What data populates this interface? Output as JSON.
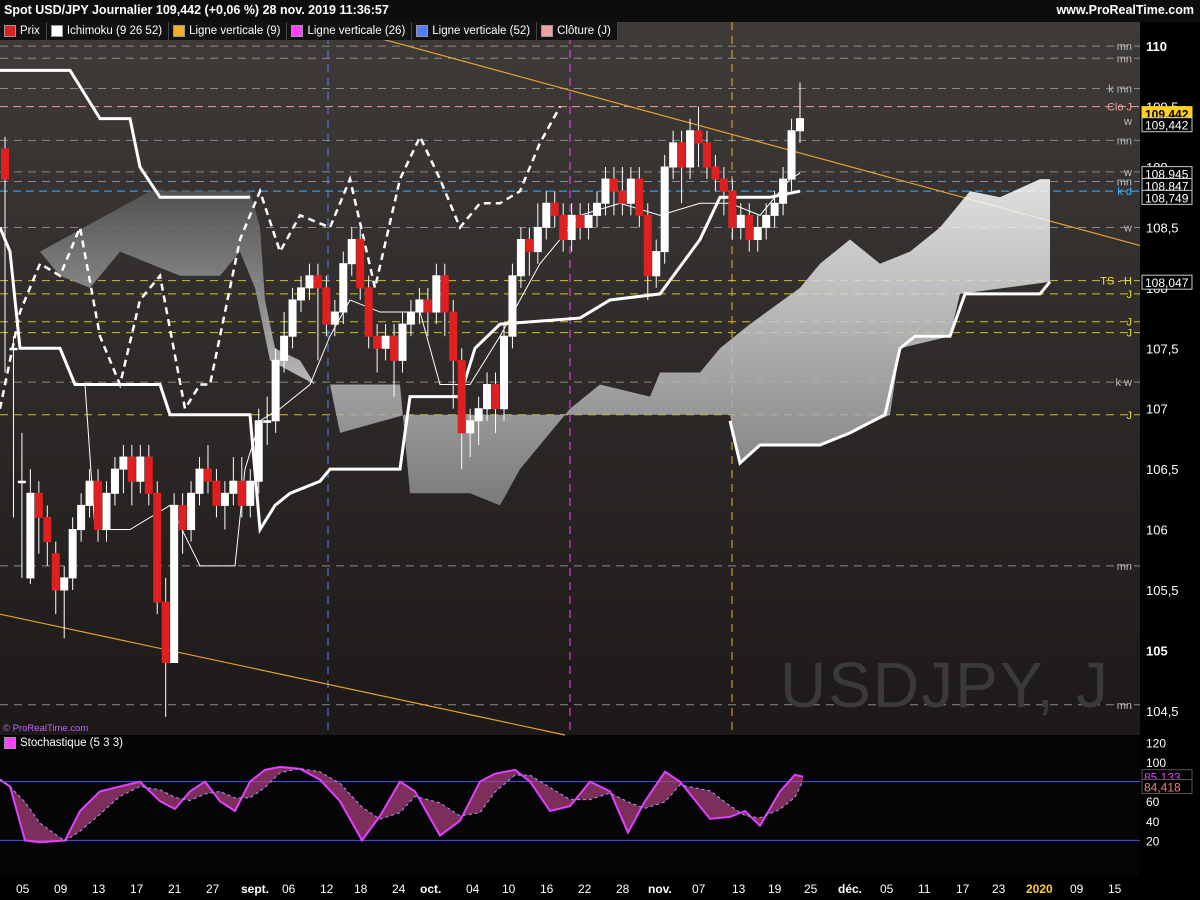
{
  "header": {
    "title": "Spot USD/JPY Journalier 109,442 (+0,06 %) 28 nov. 2019 11:36:57",
    "site": "www.ProRealTime.com"
  },
  "legend": [
    {
      "label": "Prix",
      "color": "#e02020"
    },
    {
      "label": "Ichimoku (9 26 52)",
      "color": "#ffffff"
    },
    {
      "label": "Ligne verticale (9)",
      "color": "#f0b020"
    },
    {
      "label": "Ligne verticale (26)",
      "color": "#ff40ff"
    },
    {
      "label": "Ligne verticale (52)",
      "color": "#5080ff"
    },
    {
      "label": "Clôture (J)",
      "color": "#f0a0a0"
    }
  ],
  "stoch_legend": {
    "label": "Stochastique (5 3 3)",
    "color": "#ff40ff"
  },
  "watermark": "USDJPY, J",
  "copyright": "© ProRealTime.com",
  "chart_data": {
    "type": "candlestick",
    "ylim": [
      104.3,
      110.2
    ],
    "y_ticks": [
      "110",
      "109,5",
      "109",
      "108,5",
      "108",
      "107,5",
      "107",
      "106,5",
      "106",
      "105,5",
      "105",
      "104,5"
    ],
    "x_labels": [
      "05",
      "09",
      "13",
      "17",
      "21",
      "27",
      "sept.",
      "06",
      "12",
      "18",
      "24",
      "oct.",
      "04",
      "10",
      "16",
      "22",
      "28",
      "nov.",
      "07",
      "13",
      "19",
      "25",
      "déc.",
      "05",
      "11",
      "17",
      "23",
      "2020",
      "09",
      "15"
    ],
    "price_labels": [
      {
        "text": "109,442",
        "value": 109.442,
        "highlight": true
      },
      {
        "text": "109,442",
        "value": 109.35
      },
      {
        "text": "108,945",
        "value": 108.945
      },
      {
        "text": "108,847",
        "value": 108.847
      },
      {
        "text": "108,749",
        "value": 108.749
      },
      {
        "text": "108,047",
        "value": 108.047
      }
    ],
    "side_marks": [
      {
        "text": "mn",
        "value": 110.0
      },
      {
        "text": "mn",
        "value": 109.9
      },
      {
        "text": "k mn",
        "value": 109.65
      },
      {
        "text": "Clo J",
        "value": 109.5
      },
      {
        "text": "w",
        "value": 109.38
      },
      {
        "text": "mn",
        "value": 109.22
      },
      {
        "text": "w",
        "value": 108.96
      },
      {
        "text": "mn",
        "value": 108.88
      },
      {
        "text": "k d",
        "value": 108.8
      },
      {
        "text": "w",
        "value": 108.5
      },
      {
        "text": "TS - H",
        "value": 108.06
      },
      {
        "text": "J",
        "value": 107.95
      },
      {
        "text": "J",
        "value": 107.72
      },
      {
        "text": "J",
        "value": 107.63
      },
      {
        "text": "k w",
        "value": 107.22
      },
      {
        "text": "J",
        "value": 106.95
      },
      {
        "text": "mn",
        "value": 105.7
      },
      {
        "text": "mn",
        "value": 104.55
      }
    ],
    "candles": [
      [
        109.15,
        108.9,
        109.25,
        107.3
      ],
      [
        107.5,
        107.5,
        107.6,
        106.1
      ],
      [
        106.4,
        106.4,
        106.8,
        105.6
      ],
      [
        105.6,
        106.3,
        106.5,
        105.55
      ],
      [
        106.3,
        106.1,
        106.4,
        105.8
      ],
      [
        106.1,
        105.9,
        106.2,
        105.7
      ],
      [
        105.8,
        105.5,
        105.9,
        105.3
      ],
      [
        105.5,
        105.6,
        105.7,
        105.1
      ],
      [
        105.6,
        106.0,
        106.1,
        105.5
      ],
      [
        106.0,
        106.2,
        106.3,
        105.9
      ],
      [
        106.2,
        106.4,
        106.5,
        106.1
      ],
      [
        106.4,
        106.0,
        106.5,
        105.9
      ],
      [
        106.0,
        106.3,
        106.4,
        105.9
      ],
      [
        106.3,
        106.5,
        106.6,
        106.2
      ],
      [
        106.5,
        106.6,
        106.7,
        106.3
      ],
      [
        106.6,
        106.4,
        106.7,
        106.2
      ],
      [
        106.4,
        106.6,
        106.7,
        106.3
      ],
      [
        106.6,
        106.3,
        106.7,
        106.2
      ],
      [
        106.3,
        105.4,
        106.4,
        105.3
      ],
      [
        105.4,
        104.9,
        105.6,
        104.45
      ],
      [
        104.9,
        106.2,
        106.3,
        104.9
      ],
      [
        106.2,
        106.0,
        106.3,
        105.8
      ],
      [
        106.0,
        106.3,
        106.4,
        105.9
      ],
      [
        106.3,
        106.5,
        106.6,
        106.2
      ],
      [
        106.5,
        106.4,
        106.7,
        106.3
      ],
      [
        106.4,
        106.2,
        106.5,
        106.1
      ],
      [
        106.2,
        106.3,
        106.4,
        106.0
      ],
      [
        106.3,
        106.4,
        106.6,
        106.2
      ],
      [
        106.4,
        106.2,
        106.6,
        106.1
      ],
      [
        106.2,
        106.4,
        106.5,
        106.1
      ],
      [
        106.4,
        106.9,
        107.0,
        106.3
      ],
      [
        106.9,
        106.9,
        107.1,
        106.7
      ],
      [
        106.9,
        107.4,
        107.5,
        106.8
      ],
      [
        107.4,
        107.6,
        107.8,
        107.3
      ],
      [
        107.6,
        107.9,
        108.0,
        107.5
      ],
      [
        107.9,
        108.0,
        108.1,
        107.8
      ],
      [
        108.0,
        108.1,
        108.2,
        107.9
      ],
      [
        108.1,
        108.0,
        108.2,
        107.4
      ],
      [
        108.0,
        107.7,
        108.1,
        107.6
      ],
      [
        107.7,
        107.8,
        107.9,
        107.6
      ],
      [
        107.8,
        108.2,
        108.3,
        107.7
      ],
      [
        108.2,
        108.4,
        108.5,
        108.1
      ],
      [
        108.4,
        108.0,
        108.5,
        107.9
      ],
      [
        108.0,
        107.6,
        108.1,
        107.5
      ],
      [
        107.6,
        107.5,
        107.7,
        107.3
      ],
      [
        107.5,
        107.6,
        107.7,
        107.4
      ],
      [
        107.6,
        107.4,
        107.7,
        107.1
      ],
      [
        107.4,
        107.7,
        107.8,
        107.3
      ],
      [
        107.7,
        107.8,
        107.9,
        107.6
      ],
      [
        107.8,
        107.9,
        108.0,
        107.7
      ],
      [
        107.9,
        107.8,
        108.0,
        107.6
      ],
      [
        107.8,
        108.1,
        108.2,
        107.7
      ],
      [
        108.1,
        107.8,
        108.2,
        107.6
      ],
      [
        107.8,
        107.4,
        107.9,
        107.0
      ],
      [
        107.4,
        106.8,
        107.5,
        106.5
      ],
      [
        106.8,
        106.9,
        107.0,
        106.6
      ],
      [
        106.9,
        107.0,
        107.1,
        106.7
      ],
      [
        107.0,
        107.2,
        107.3,
        106.9
      ],
      [
        107.2,
        107.0,
        107.3,
        106.8
      ],
      [
        107.0,
        107.6,
        107.7,
        106.9
      ],
      [
        107.6,
        108.1,
        108.2,
        107.5
      ],
      [
        108.1,
        108.4,
        108.5,
        108.0
      ],
      [
        108.4,
        108.3,
        108.5,
        108.1
      ],
      [
        108.3,
        108.5,
        108.7,
        108.2
      ],
      [
        108.5,
        108.7,
        108.8,
        108.4
      ],
      [
        108.7,
        108.6,
        108.8,
        108.5
      ],
      [
        108.6,
        108.4,
        108.7,
        108.3
      ],
      [
        108.4,
        108.6,
        108.7,
        108.3
      ],
      [
        108.6,
        108.5,
        108.7,
        108.4
      ],
      [
        108.5,
        108.6,
        108.7,
        108.4
      ],
      [
        108.6,
        108.7,
        108.8,
        108.5
      ],
      [
        108.7,
        108.9,
        109.0,
        108.6
      ],
      [
        108.9,
        108.8,
        109.0,
        108.6
      ],
      [
        108.8,
        108.7,
        109.0,
        108.6
      ],
      [
        108.7,
        108.9,
        109.0,
        108.6
      ],
      [
        108.9,
        108.6,
        109.0,
        108.5
      ],
      [
        108.6,
        108.1,
        108.7,
        107.9
      ],
      [
        108.1,
        108.3,
        108.4,
        108.0
      ],
      [
        108.3,
        109.0,
        109.1,
        108.2
      ],
      [
        109.0,
        109.2,
        109.3,
        108.9
      ],
      [
        109.2,
        109.0,
        109.3,
        108.7
      ],
      [
        109.0,
        109.3,
        109.4,
        108.9
      ],
      [
        109.3,
        109.2,
        109.5,
        109.0
      ],
      [
        109.2,
        109.0,
        109.3,
        108.9
      ],
      [
        109.0,
        108.9,
        109.1,
        108.8
      ],
      [
        108.9,
        108.8,
        109.0,
        108.6
      ],
      [
        108.8,
        108.5,
        108.9,
        108.4
      ],
      [
        108.5,
        108.6,
        108.7,
        108.4
      ],
      [
        108.6,
        108.4,
        108.7,
        108.3
      ],
      [
        108.4,
        108.5,
        108.6,
        108.3
      ],
      [
        108.5,
        108.6,
        108.7,
        108.4
      ],
      [
        108.6,
        108.7,
        108.8,
        108.5
      ],
      [
        108.7,
        108.9,
        109.0,
        108.6
      ],
      [
        108.9,
        109.3,
        109.4,
        108.8
      ],
      [
        109.3,
        109.4,
        109.7,
        109.2
      ]
    ],
    "stochastic": {
      "ylim": [
        0,
        120
      ],
      "ticks": [
        "120",
        "100",
        "80",
        "60",
        "40",
        "20"
      ],
      "levels": [
        80,
        20
      ],
      "k_label": "85,133",
      "d_label": "84,418"
    }
  }
}
